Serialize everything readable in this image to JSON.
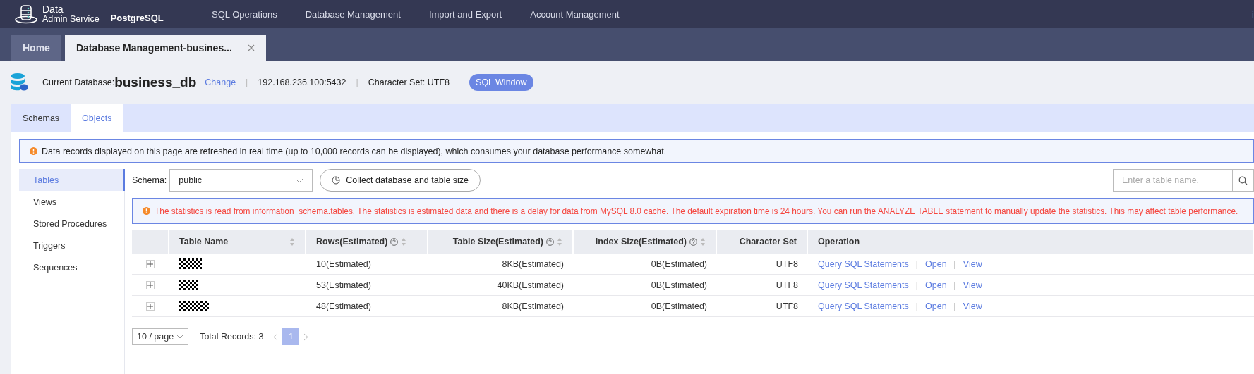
{
  "brand": {
    "title": "Data",
    "subtitle": "Admin Service",
    "engine": "PostgreSQL"
  },
  "nav": [
    "SQL Operations",
    "Database Management",
    "Import and Export",
    "Account Management"
  ],
  "user_menu": "i",
  "page_tabs": [
    {
      "label": "Home",
      "selected": false,
      "closable": false
    },
    {
      "label": "Database Management-busines...",
      "selected": true,
      "closable": true
    }
  ],
  "db_info": {
    "label": "Current Database:",
    "name": "business_db",
    "change": "Change",
    "separators": [
      "|",
      "|"
    ],
    "address": "192.168.236.100:5432",
    "charset": "Character Set: UTF8",
    "sql_button": "SQL Window"
  },
  "tabs": [
    {
      "label": "Schemas",
      "selected": false
    },
    {
      "label": "Objects",
      "selected": true
    }
  ],
  "notice": "Data records displayed on this page are refreshed in real time (up to 10,000 records can be displayed), which consumes your database performance somewhat.",
  "sidebar": {
    "items": [
      {
        "label": "Tables",
        "selected": true
      },
      {
        "label": "Views",
        "selected": false
      },
      {
        "label": "Stored Procedures",
        "selected": false
      },
      {
        "label": "Triggers",
        "selected": false
      },
      {
        "label": "Sequences",
        "selected": false
      }
    ]
  },
  "toolbar": {
    "schema_label": "Schema:",
    "schema_value": "public",
    "collect_button": "Collect database and table size",
    "search_placeholder": "Enter a table name."
  },
  "stats_notice": "The statistics is read from information_schema.tables. The statistics is estimated data and there is a delay for data from MySQL 8.0 cache. The default expiration time is 24 hours. You can run the ANALYZE TABLE statement to manually update the statistics. This may affect table performance.",
  "table": {
    "columns": [
      {
        "label": "Table Name",
        "help": false,
        "sortable": true
      },
      {
        "label": "Rows(Estimated)",
        "help": true,
        "sortable": true
      },
      {
        "label": "Table Size(Estimated)",
        "help": true,
        "sortable": true
      },
      {
        "label": "Index Size(Estimated)",
        "help": true,
        "sortable": true
      },
      {
        "label": "Character Set",
        "help": false,
        "sortable": false
      },
      {
        "label": "Operation",
        "help": false,
        "sortable": false
      }
    ],
    "rows": [
      {
        "name": {
          "kind": "redacted"
        },
        "rows": "10(Estimated)",
        "table_size": "8KB(Estimated)",
        "index_size": "0B(Estimated)",
        "charset": "UTF8",
        "actions": [
          "Query SQL Statements",
          "Open",
          "View"
        ],
        "action_separators": [
          "|",
          "|"
        ]
      },
      {
        "name": {
          "kind": "redacted"
        },
        "rows": "53(Estimated)",
        "table_size": "40KB(Estimated)",
        "index_size": "0B(Estimated)",
        "charset": "UTF8",
        "actions": [
          "Query SQL Statements",
          "Open",
          "View"
        ],
        "action_separators": [
          "|",
          "|"
        ]
      },
      {
        "name": {
          "kind": "redacted"
        },
        "rows": "48(Estimated)",
        "table_size": "8KB(Estimated)",
        "index_size": "0B(Estimated)",
        "charset": "UTF8",
        "actions": [
          "Query SQL Statements",
          "Open",
          "View"
        ],
        "action_separators": [
          "|",
          "|"
        ]
      }
    ]
  },
  "pagination": {
    "page_size": "10 / page",
    "total": "Total Records: 3",
    "pages": [
      {
        "label": "1",
        "selected": true
      }
    ]
  }
}
